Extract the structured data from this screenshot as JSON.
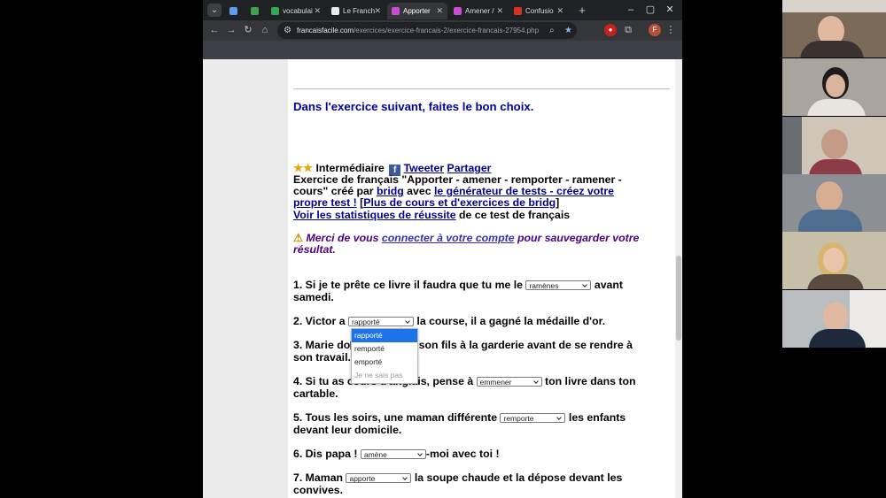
{
  "browser": {
    "tabs": [
      {
        "title": "",
        "favicon_color": "#5f9cef",
        "active": false
      },
      {
        "title": "",
        "favicon_color": "#3fa34d",
        "active": false
      },
      {
        "title": "vocabulai",
        "favicon_color": "#34a853",
        "active": false
      },
      {
        "title": "Le Franch",
        "favicon_color": "#e8eaed",
        "active": false
      },
      {
        "title": "Apporter",
        "favicon_color": "#c94cd4",
        "active": true
      },
      {
        "title": "Amener /",
        "favicon_color": "#c94cd4",
        "active": false
      },
      {
        "title": "Confusio",
        "favicon_color": "#d93025",
        "active": false
      }
    ],
    "url_host": "francaisfacile.com",
    "url_path": "/exercices/exercice-francais-2/exercice-francais-27954.php",
    "profile_initial": "F"
  },
  "page": {
    "instruction": "Dans l'exercice suivant, faites le bon choix.",
    "level": "Intermédiaire",
    "tweeter": "Tweeter",
    "partager": "Partager",
    "desc_l1": "Exercice de français \"Apporter - amener - remporter - ramener -",
    "desc_l2a": "cours\" créé par ",
    "author": "bridg",
    "desc_l2b": " avec ",
    "generator_link_a": "le générateur de tests - créez votre",
    "generator_link_b": "propre test !",
    "bracket_open": " [",
    "more_link": "Plus de cours et d'exercices de bridg",
    "bracket_close": "]",
    "stats_link": "Voir les statistiques de réussite",
    "stats_tail": " de ce test de français",
    "notice_a": "Merci de vous ",
    "notice_link": "connecter à votre compte",
    "notice_b": " pour sauvegarder votre",
    "notice_c": "résultat.",
    "q1_a": "1. Si je te prête ce livre il faudra que tu me le ",
    "q1_sel": "ramènes",
    "q1_b": " avant",
    "q1_c": "samedi.",
    "q2_a": "2. Victor a ",
    "q2_sel": "rapporté",
    "q2_b": " la course, il a gagné la médaille d'or.",
    "q3_a": "3. Marie do",
    "q3_b": " son fils à la garderie avant de se rendre à",
    "q3_c": "son travail.",
    "q4_a": "4. Si tu as cours d'anglais, pense à ",
    "q4_sel": "emmener",
    "q4_b": " ton livre dans ton",
    "q4_c": "cartable.",
    "q5_a": "5. Tous les soirs, une maman différente ",
    "q5_sel": "remporte",
    "q5_b": " les enfants",
    "q5_c": "devant leur domicile.",
    "q6_a": "6. Dis papa ! ",
    "q6_sel": "amène",
    "q6_b": "-moi avec toi !",
    "q7_a": "7. Maman ",
    "q7_sel": "apporte",
    "q7_b": " la soupe chaude et la dépose devant les",
    "q7_c": "convives.",
    "dropdown_options": [
      "rapporté",
      "remporté",
      "emporté",
      "Je ne sais pas"
    ]
  },
  "colors": {
    "accent": "#1a73e8",
    "heading": "#0000a0",
    "link": "#00008b",
    "notice": "#4b0082"
  }
}
